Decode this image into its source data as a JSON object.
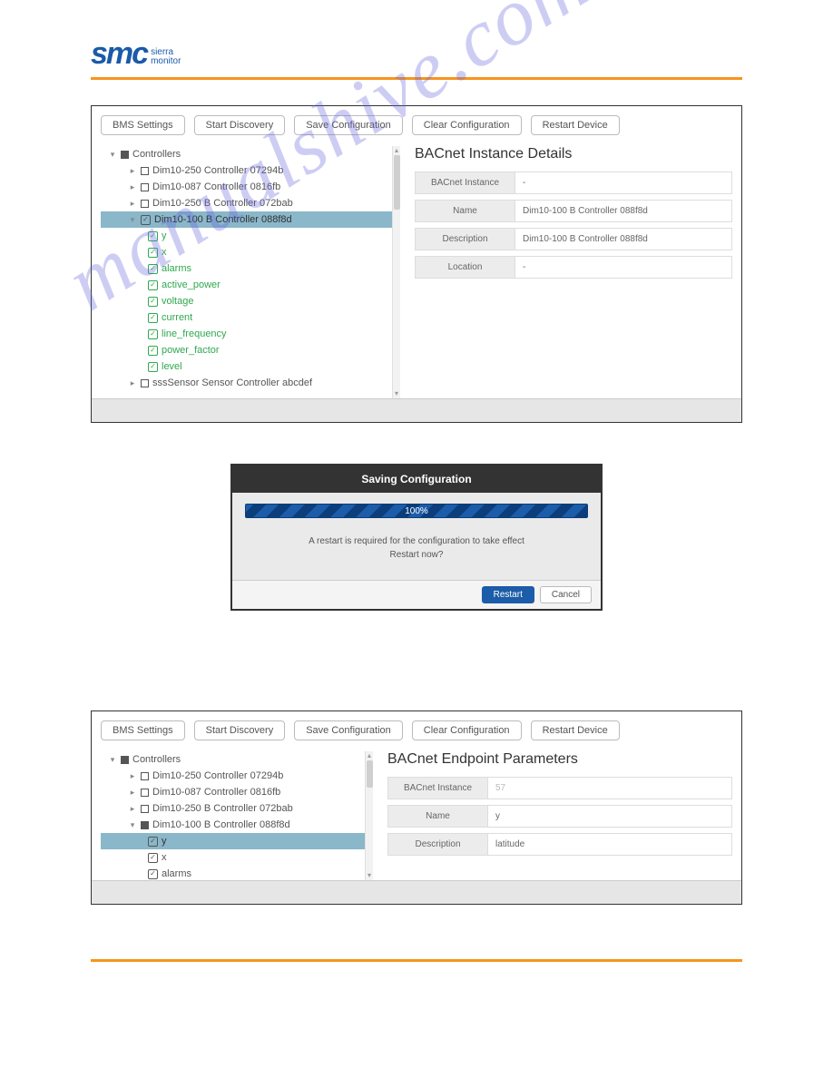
{
  "watermark": "manualshive.com",
  "logo": {
    "main": "smc",
    "sub1": "sierra",
    "sub2": "monitor"
  },
  "panel1": {
    "buttons": [
      "BMS Settings",
      "Start Discovery",
      "Save Configuration",
      "Clear Configuration",
      "Restart Device"
    ],
    "tree_root": "Controllers",
    "tree_items": [
      "Dim10-250 Controller 07294b",
      "Dim10-087 Controller 0816fb",
      "Dim10-250 B Controller 072bab",
      "Dim10-100 B Controller 088f8d"
    ],
    "tree_children": [
      "y",
      "x",
      "alarms",
      "active_power",
      "voltage",
      "current",
      "line_frequency",
      "power_factor",
      "level"
    ],
    "tree_last": "sssSensor Sensor Controller abcdef",
    "details_title": "BACnet Instance Details",
    "rows": [
      {
        "label": "BACnet Instance",
        "value": "-"
      },
      {
        "label": "Name",
        "value": "Dim10-100 B Controller 088f8d"
      },
      {
        "label": "Description",
        "value": "Dim10-100 B Controller 088f8d"
      },
      {
        "label": "Location",
        "value": "-"
      }
    ]
  },
  "dialog": {
    "title": "Saving Configuration",
    "progress_text": "100%",
    "msg1": "A restart is required for the configuration to take effect",
    "msg2": "Restart now?",
    "primary": "Restart",
    "cancel": "Cancel"
  },
  "panel2": {
    "buttons": [
      "BMS Settings",
      "Start Discovery",
      "Save Configuration",
      "Clear Configuration",
      "Restart Device"
    ],
    "tree_root": "Controllers",
    "tree_items": [
      "Dim10-250 Controller 07294b",
      "Dim10-087 Controller 0816fb",
      "Dim10-250 B Controller 072bab",
      "Dim10-100 B Controller 088f8d"
    ],
    "tree_children": [
      "y",
      "x",
      "alarms"
    ],
    "details_title": "BACnet Endpoint Parameters",
    "rows": [
      {
        "label": "BACnet Instance",
        "value": "57"
      },
      {
        "label": "Name",
        "value": "y"
      },
      {
        "label": "Description",
        "value": "latitude"
      }
    ]
  }
}
